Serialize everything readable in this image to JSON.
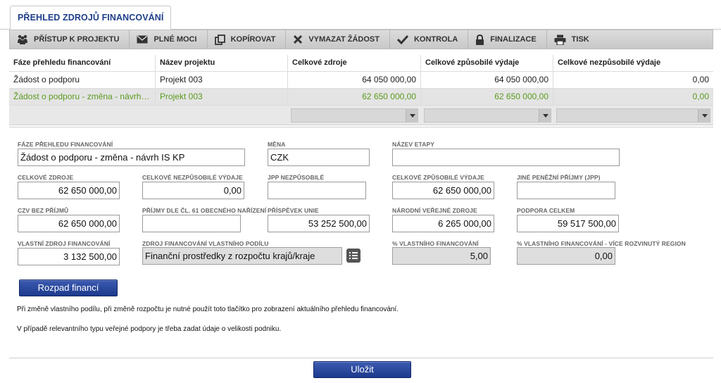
{
  "tab": {
    "label": "PŘEHLED ZDROJŮ FINANCOVÁNÍ"
  },
  "toolbar": {
    "items": [
      {
        "label": "PŘÍSTUP K PROJEKTU",
        "icon": "users-icon"
      },
      {
        "label": "PLNÉ MOCI",
        "icon": "envelope-icon"
      },
      {
        "label": "KOPÍROVAT",
        "icon": "copy-icon"
      },
      {
        "label": "VYMAZAT ŽÁDOST",
        "icon": "cross-icon"
      },
      {
        "label": "KONTROLA",
        "icon": "checkmark-icon"
      },
      {
        "label": "FINALIZACE",
        "icon": "lock-icon"
      },
      {
        "label": "TISK",
        "icon": "printer-icon"
      }
    ]
  },
  "grid": {
    "headers": [
      "Fáze přehledu financování",
      "Název projektu",
      "Celkové zdroje",
      "Celkové způsobilé výdaje",
      "Celkové nezpůsobilé výdaje"
    ],
    "rows": [
      [
        "Žádost o podporu",
        "Projekt 003",
        "64 050 000,00",
        "64 050 000,00",
        "0,00"
      ],
      [
        "Žádost o podporu - změna - návrh IS...",
        "Projekt 003",
        "62 650 000,00",
        "62 650 000,00",
        "0,00"
      ]
    ],
    "selected_row_color": "#5a9a1e"
  },
  "form": {
    "faze_label": "FÁZE PŘEHLEDU FINANCOVÁNÍ",
    "faze_value": "Žádost o podporu - změna - návrh IS KP",
    "mena_label": "MĚNA",
    "mena_value": "CZK",
    "etapa_label": "NÁZEV ETAPY",
    "etapa_value": "",
    "celk_zdroje_label": "CELKOVÉ ZDROJE",
    "celk_zdroje_value": "62 650 000,00",
    "celk_nezp_label": "CELKOVÉ NEZPŮSOBILÉ VÝDAJE",
    "celk_nezp_value": "0,00",
    "jpp_nezp_label": "JPP NEZPŮSOBILÉ",
    "jpp_nezp_value": "",
    "celk_zp_label": "CELKOVÉ ZPŮSOBILÉ VÝDAJE",
    "celk_zp_value": "62 650 000,00",
    "jine_label": "JINÉ PENĚŽNÍ PŘÍJMY (JPP)",
    "jine_value": "",
    "czv_label": "CZV BEZ PŘÍJMŮ",
    "czv_value": "62 650 000,00",
    "prijmy_label": "PŘÍJMY DLE ČL. 61 OBECNÉHO NAŘÍZENÍ",
    "prijmy_value": "",
    "prispevek_label": "PŘÍSPĚVEK UNIE",
    "prispevek_value": "53 252 500,00",
    "narodni_label": "NÁRODNÍ VEŘEJNÉ ZDROJE",
    "narodni_value": "6 265 000,00",
    "podpora_label": "PODPORA CELKEM",
    "podpora_value": "59 517 500,00",
    "vlastni_label": "VLASTNÍ ZDROJ FINANCOVÁNÍ",
    "vlastni_value": "3 132 500,00",
    "zdroj_vp_label": "ZDROJ FINANCOVÁNÍ VLASTNÍHO PODÍLU",
    "zdroj_vp_value": "Finanční prostředky z rozpočtu krajů/kraje",
    "pct_vf_label": "% VLASTNÍHO FINANCOVÁNÍ",
    "pct_vf_value": "5,00",
    "pct_vr_label": "% VLASTNÍHO FINANCOVÁNÍ - VÍCE ROZVINUTÝ REGION",
    "pct_vr_value": "0,00"
  },
  "rozpad_button": "Rozpad financí",
  "notes": [
    "Při změně vlastního podílu, při změně rozpočtu je nutné použít toto tlačítko pro zobrazení aktuálního přehledu financování.",
    "V případě relevantního typu veřejné podpory je třeba zadat údaje o velikosti podniku."
  ],
  "save_button": "Uložit",
  "colors": {
    "accent": "#1f3f8a",
    "button": "#1c3a8c",
    "selected_text": "#5a9a1e"
  }
}
